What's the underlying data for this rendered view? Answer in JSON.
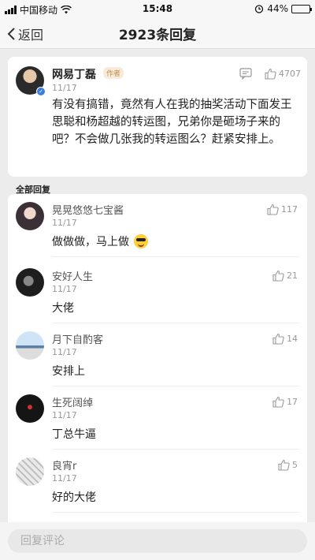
{
  "status_bar": {
    "carrier": "中国移动",
    "time": "15:48",
    "battery": "44%",
    "battery_level": 0.44
  },
  "nav": {
    "back_label": "返回",
    "title": "2923条回复"
  },
  "main_comment": {
    "author": "网易丁磊",
    "author_tag": "作者",
    "date": "11/17",
    "likes": "4707",
    "text": "有没有搞错，竟然有人在我的抽奖活动下面发王思聪和杨超越的转运图，兄弟你是砸场子来的吧？不会做几张我的转运图么？赶紧安排上。"
  },
  "section_label": "全部回复",
  "replies": [
    {
      "name": "晃晃悠悠七宝酱",
      "date": "11/17",
      "text": "做做做，马上做",
      "likes": "117",
      "avatar_icon": "avatar-girl-icon",
      "emoji": "sunglasses-emoji-icon"
    },
    {
      "name": "安好人生",
      "date": "11/17",
      "text": "大佬",
      "likes": "21",
      "avatar_icon": "avatar-dark-icon"
    },
    {
      "name": "月下自酌客",
      "date": "11/17",
      "text": "安排上",
      "likes": "14",
      "avatar_icon": "avatar-landscape-icon"
    },
    {
      "name": "生死阔绰",
      "date": "11/17",
      "text": "丁总牛逼",
      "likes": "17",
      "avatar_icon": "avatar-mask-icon"
    },
    {
      "name": "良宵r",
      "date": "11/17",
      "text": "好的大佬",
      "likes": "5",
      "avatar_icon": "avatar-sketch-icon"
    }
  ],
  "input": {
    "placeholder": "回复评论"
  },
  "colors": {
    "background": "#ececec",
    "author_tag": "#c58b4a",
    "verified_badge": "#3b7de0"
  }
}
